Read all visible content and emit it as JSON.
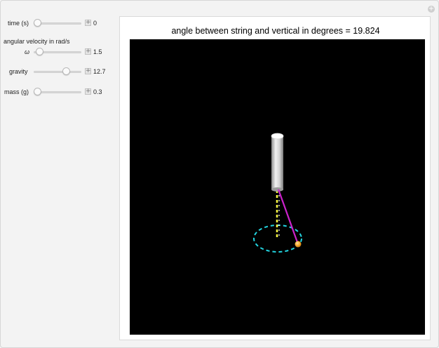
{
  "controls": {
    "time": {
      "label": "time (s)",
      "value": "0",
      "fraction": 0.0
    },
    "angular_velocity": {
      "header": "angular velocity in rad/s",
      "label": "ω",
      "value": "1.5",
      "fraction": 0.05
    },
    "gravity": {
      "label": "gravity",
      "value": "12.7",
      "fraction": 0.72
    },
    "mass": {
      "label": "mass (g)",
      "value": "0.3",
      "fraction": 0.0
    }
  },
  "plot": {
    "title": "angle between string and vertical in degrees = 19.824",
    "angle_degrees": 19.824
  },
  "colors": {
    "background": "#000000",
    "string": "#cc22cc",
    "axis_dashes": "#ffff44",
    "orbit": "#22d4e0",
    "bob": "#f5a623",
    "cylinder": "#e0e0e0"
  }
}
